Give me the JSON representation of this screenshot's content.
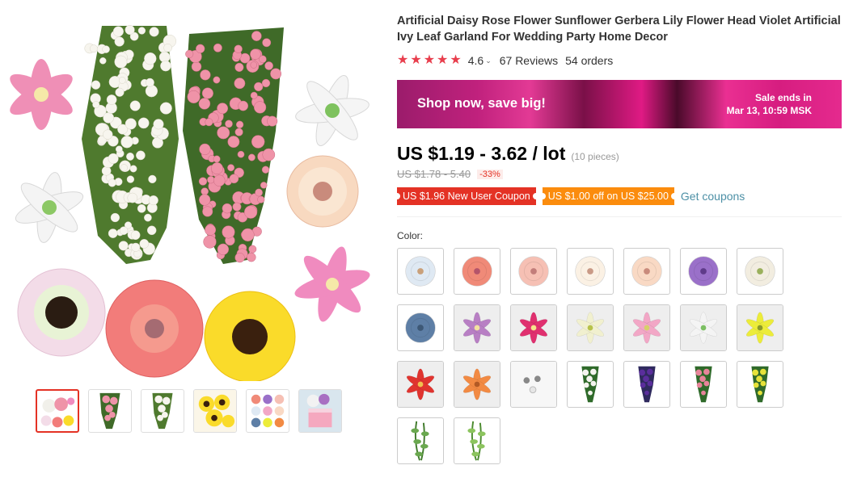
{
  "product": {
    "title": "Artificial Daisy Rose Flower Sunflower Gerbera Lily Flower Head Violet Artificial Ivy Leaf Garland For Wedding Party Home Decor",
    "rating": "4.6",
    "rating_caret": "⌄",
    "reviews": "67 Reviews",
    "orders": "54 orders",
    "stars": 5
  },
  "banner": {
    "headline": "Shop now, save big!",
    "sale_line1": "Sale ends in",
    "sale_line2": "Mar 13, 10:59 MSK"
  },
  "price": {
    "current": "US $1.19 - 3.62 / lot",
    "pieces": "(10 pieces)",
    "original": "US $1.78 - 5.40",
    "discount": "-33%"
  },
  "coupons": {
    "new_user": "US $1.96 New User Coupon",
    "off": "US $1.00 off on US $25.00",
    "get": "Get coupons"
  },
  "color_label": "Color:",
  "colors": {
    "star": "#e83e4d",
    "accent_red": "#e43225",
    "coupon_orange": "#fb8c0d",
    "link": "#4d90a6"
  },
  "swatches": [
    {
      "kind": "flower",
      "color": "#dfe9f3",
      "center": "#c9a07a"
    },
    {
      "kind": "flower",
      "color": "#f08a78",
      "center": "#b5546a"
    },
    {
      "kind": "flower",
      "color": "#f6c0b4",
      "center": "#c27d7a"
    },
    {
      "kind": "flower",
      "color": "#fbf1e4",
      "center": "#c99a86"
    },
    {
      "kind": "flower",
      "color": "#f9d9c4",
      "center": "#c98b7c"
    },
    {
      "kind": "flower",
      "color": "#9a70c9",
      "center": "#5f3b8a"
    },
    {
      "kind": "flower",
      "color": "#f2ede0",
      "center": "#9ab05c"
    },
    {
      "kind": "flower",
      "color": "#5e7fa6",
      "center": "#3d5876"
    },
    {
      "kind": "lily",
      "color": "#b87fc4",
      "center": "#f3e2a0"
    },
    {
      "kind": "lily",
      "color": "#e0306f",
      "center": "#f5e48b"
    },
    {
      "kind": "lily",
      "color": "#f1f0cf",
      "center": "#b7c24a"
    },
    {
      "kind": "lily",
      "color": "#f2a7c6",
      "center": "#d6d06a"
    },
    {
      "kind": "lily",
      "color": "#f4f4f4",
      "center": "#7cbf63"
    },
    {
      "kind": "lily",
      "color": "#ecec3a",
      "center": "#8b9a2a"
    },
    {
      "kind": "lily",
      "color": "#e0342f",
      "center": "#f0c050"
    },
    {
      "kind": "lily",
      "color": "#f28a43",
      "center": "#b25a25"
    },
    {
      "kind": "dots",
      "color": "#e6e6e6",
      "center": "#888888"
    },
    {
      "kind": "hanging",
      "color": "#f4f4ef",
      "center": "#2f6a2a"
    },
    {
      "kind": "hanging",
      "color": "#5a2e9c",
      "center": "#2f2a5e"
    },
    {
      "kind": "hanging",
      "color": "#e7849a",
      "center": "#2f6a2a"
    },
    {
      "kind": "hanging",
      "color": "#e6e23a",
      "center": "#2f6a2a"
    },
    {
      "kind": "ivy",
      "color": "#6aa84f",
      "center": "#3f7a2a"
    },
    {
      "kind": "ivy",
      "color": "#8cc45e",
      "center": "#4a8a2e"
    }
  ],
  "thumbnails": [
    {
      "kind": "mix",
      "active": true
    },
    {
      "kind": "pink-hanging",
      "active": false
    },
    {
      "kind": "white-hanging",
      "active": false
    },
    {
      "kind": "sunflower",
      "active": false
    },
    {
      "kind": "grid",
      "active": false
    },
    {
      "kind": "cake",
      "active": false
    }
  ]
}
